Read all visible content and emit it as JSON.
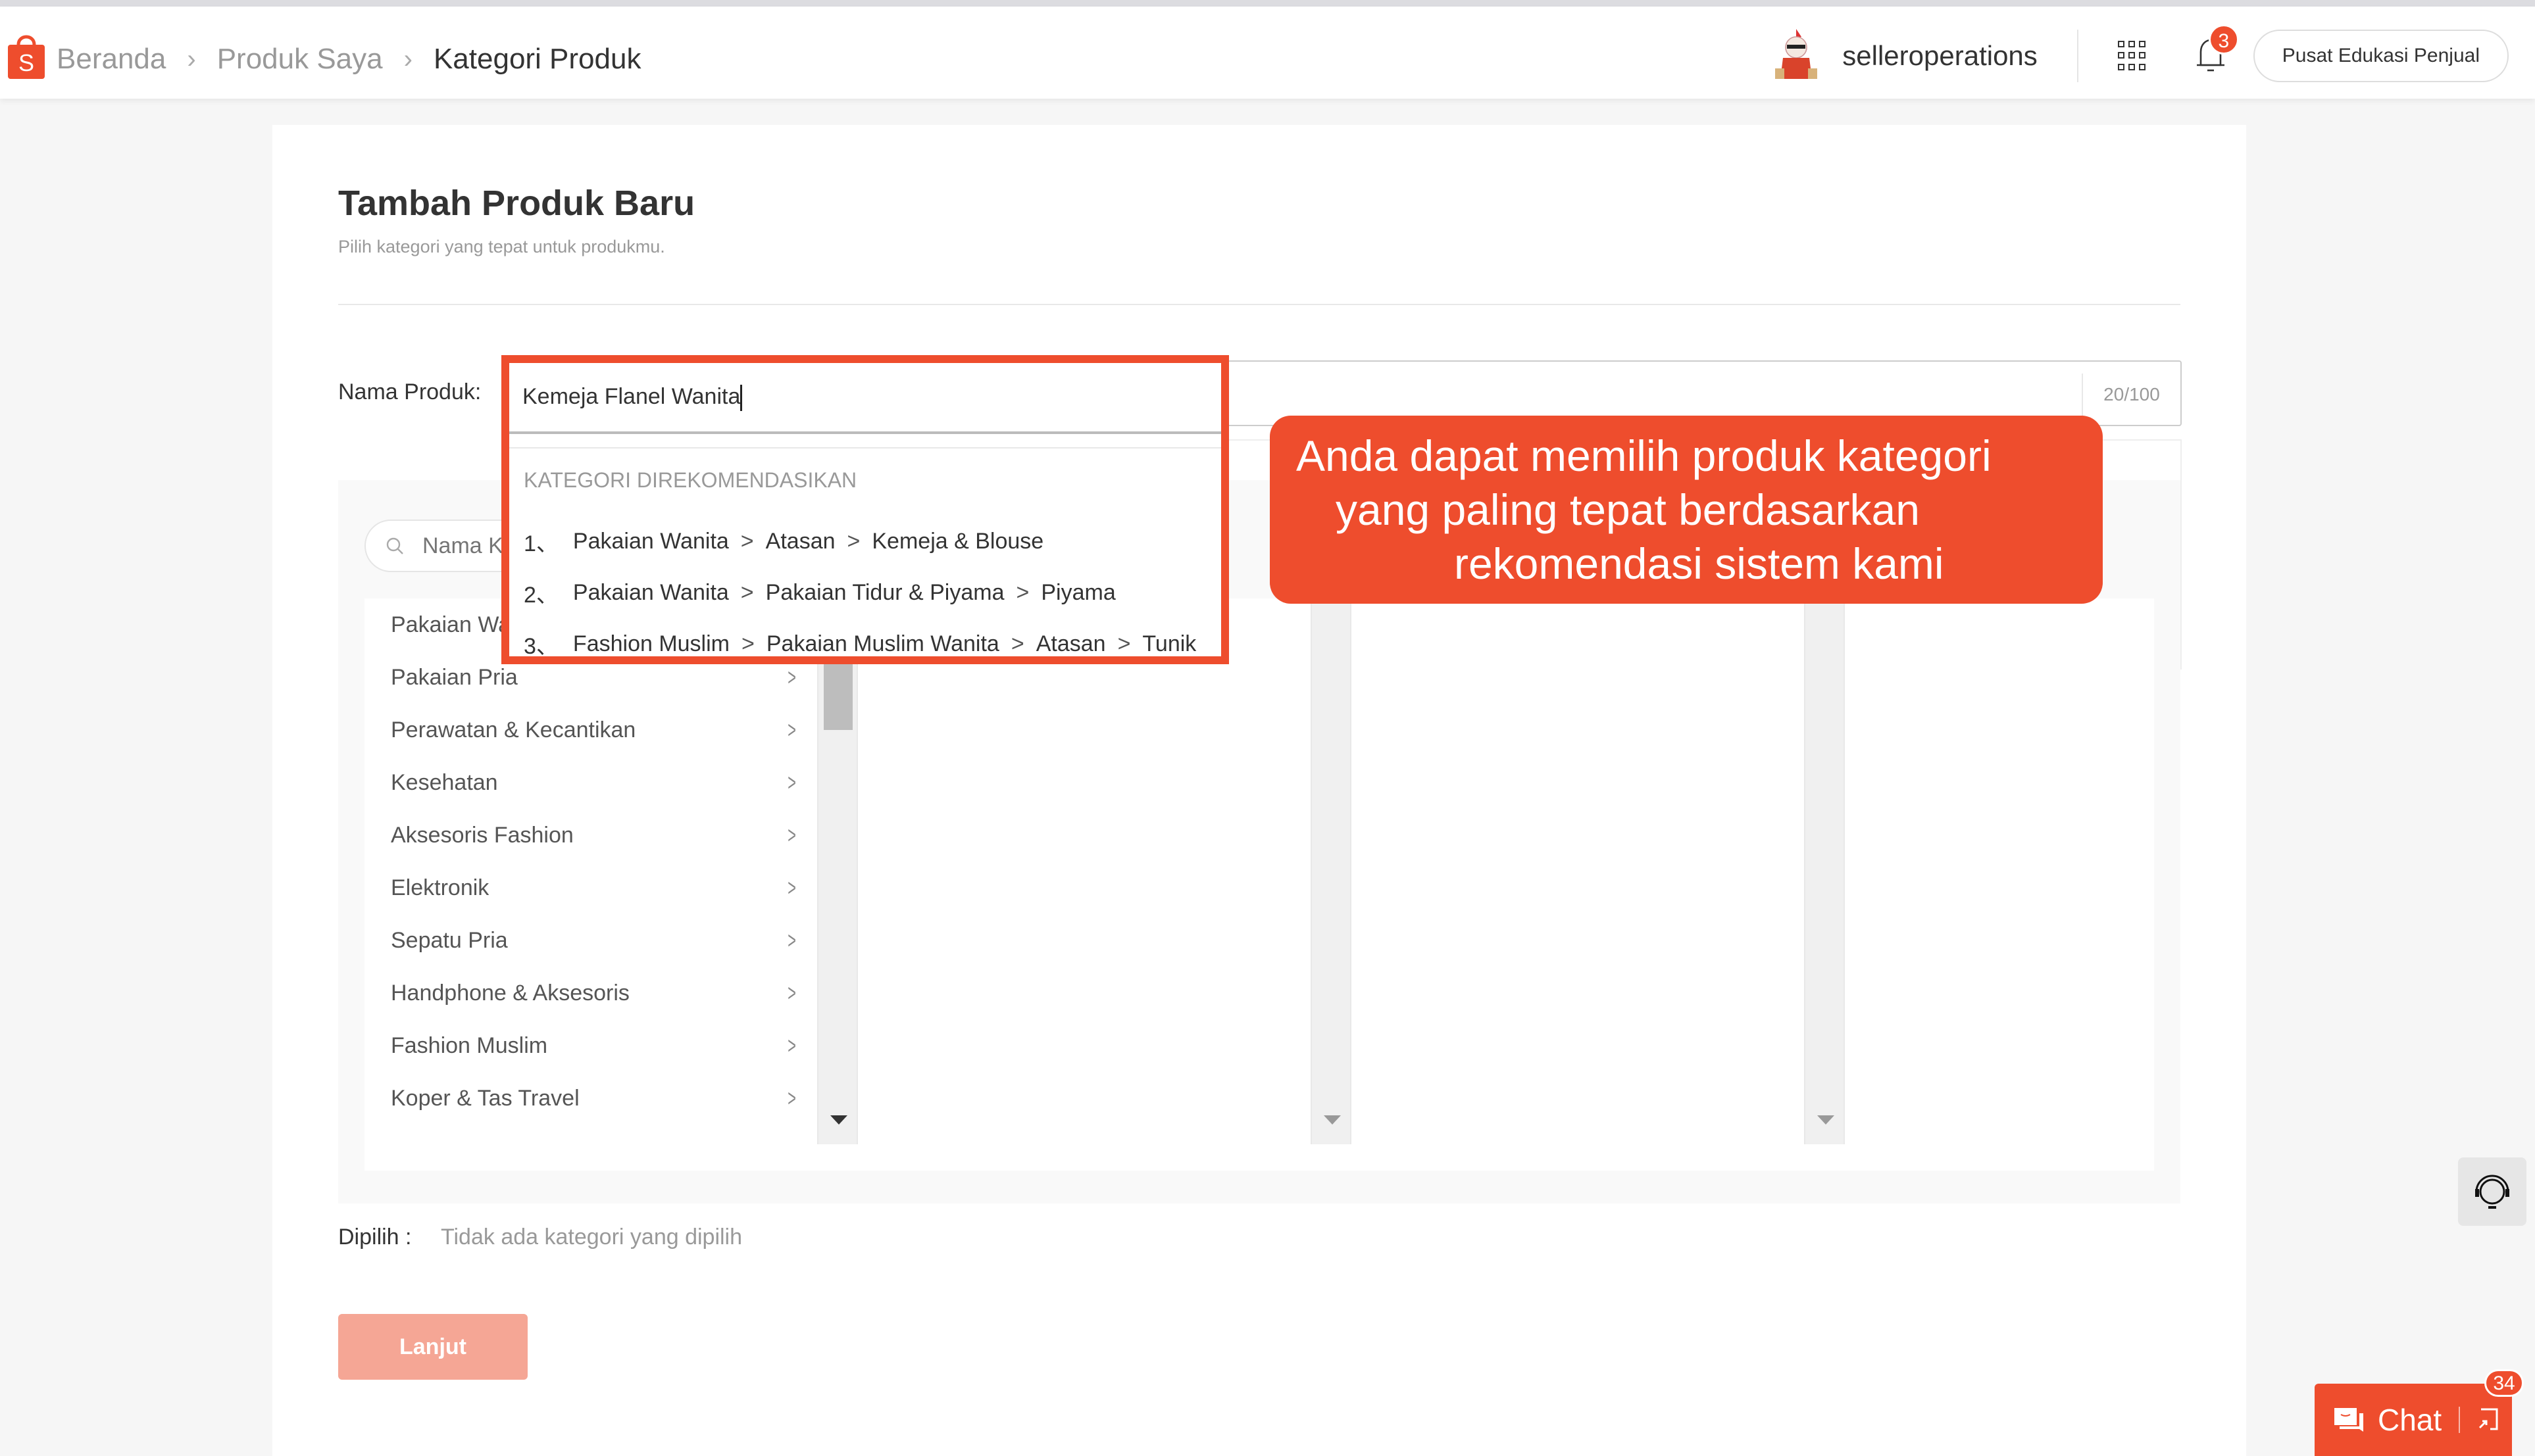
{
  "header": {
    "breadcrumbs": [
      "Beranda",
      "Produk Saya",
      "Kategori Produk"
    ],
    "username": "selleroperations",
    "notification_count": "3",
    "edu_button": "Pusat Edukasi Penjual"
  },
  "page": {
    "title": "Tambah Produk Baru",
    "subtitle": "Pilih kategori yang tepat untuk produkmu."
  },
  "product_name": {
    "label": "Nama Produk:",
    "value": "Kemeja Flanel Wanita",
    "counter": "20/100"
  },
  "recommendations": {
    "heading": "KATEGORI DIREKOMENDASIKAN",
    "items": [
      {
        "num": "1、",
        "path": [
          "Pakaian Wanita",
          "Atasan",
          "Kemeja & Blouse"
        ]
      },
      {
        "num": "2、",
        "path": [
          "Pakaian Wanita",
          "Pakaian Tidur & Piyama",
          "Piyama"
        ]
      },
      {
        "num": "3、",
        "path": [
          "Fashion Muslim",
          "Pakaian Muslim Wanita",
          "Atasan",
          "Tunik"
        ]
      }
    ]
  },
  "category_search": {
    "placeholder": "Nama Kategori"
  },
  "categories": [
    "Pakaian Wanita",
    "Pakaian Pria",
    "Perawatan & Kecantikan",
    "Kesehatan",
    "Aksesoris Fashion",
    "Elektronik",
    "Sepatu Pria",
    "Handphone & Aksesoris",
    "Fashion Muslim",
    "Koper & Tas Travel"
  ],
  "selected": {
    "label": "Dipilih :",
    "value": "Tidak ada kategori yang dipilih"
  },
  "next_button": "Lanjut",
  "callout": {
    "lines": [
      "Anda dapat memilih produk kategori",
      "yang paling tepat berdasarkan",
      "rekomendasi sistem kami"
    ]
  },
  "chat": {
    "label": "Chat",
    "badge": "34"
  },
  "colors": {
    "brand": "#ee4d2d",
    "button_disabled": "#f5a695"
  }
}
